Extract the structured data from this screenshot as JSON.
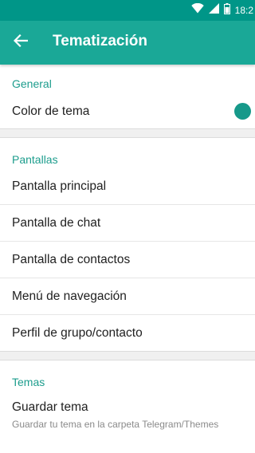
{
  "status_bar": {
    "time": "18:2",
    "icons": [
      "wifi-icon",
      "signal-icon",
      "battery-icon"
    ],
    "color": "#009688"
  },
  "app_bar": {
    "title": "Tematización",
    "back_icon": "arrow-left-icon",
    "color": "#1aa897"
  },
  "sections": {
    "general": {
      "header": "General",
      "items": [
        {
          "label": "Color de tema",
          "toggle": "on"
        }
      ]
    },
    "screens": {
      "header": "Pantallas",
      "items": [
        {
          "label": "Pantalla principal"
        },
        {
          "label": "Pantalla de chat"
        },
        {
          "label": "Pantalla de contactos"
        },
        {
          "label": "Menú de navegación"
        },
        {
          "label": "Perfil de grupo/contacto"
        }
      ]
    },
    "themes": {
      "header": "Temas",
      "items": [
        {
          "label": "Guardar tema",
          "subtitle": "Guardar tu tema en la carpeta Telegram/Themes"
        }
      ]
    }
  },
  "accent_color": "#1d9d8d"
}
